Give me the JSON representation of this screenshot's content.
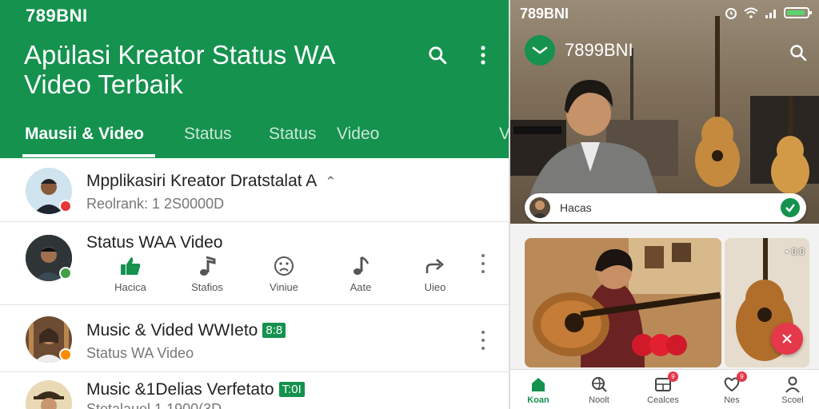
{
  "left": {
    "status_bar": {
      "text": "789BNI"
    },
    "header": {
      "title": "Apülasi Kreator Status WA Video Terbaik",
      "search_icon": "search-icon",
      "more_icon": "more-vert-icon"
    },
    "tabs": [
      {
        "label": "Mausii & Video"
      },
      {
        "label": "Status"
      },
      {
        "label": "Status"
      },
      {
        "label": "Video"
      },
      {
        "label": "V"
      }
    ],
    "rows": [
      {
        "title": "Mpplikasiri Kreator Dratstalat A",
        "subtitle": "Reolrank: 1 2S0000D",
        "badge_color": "#e53935"
      },
      {
        "title": "Status WAA Video",
        "badge_color": "#43a047"
      },
      {
        "title": "Music & Vided WWIeto",
        "tag": "8:8",
        "subtitle": "Status WA Video",
        "badge_color": "#fb8c00"
      },
      {
        "title": "Music &1Delias Verfetato",
        "tag": "T:0I",
        "subtitle": "Stetalauel 1 1900(3D"
      }
    ],
    "actions": [
      {
        "label": "Hacica",
        "icon": "thumbs-up-icon"
      },
      {
        "label": "Stafios",
        "icon": "music-note-icon"
      },
      {
        "label": "Viniue",
        "icon": "sad-face-icon"
      },
      {
        "label": "Aate",
        "icon": "music-note-icon"
      },
      {
        "label": "Uieo",
        "icon": "share-icon"
      }
    ]
  },
  "right": {
    "status_bar": {
      "text": "789BNI"
    },
    "header": {
      "title": "7899BNI"
    },
    "caption": {
      "text": "Hacas"
    },
    "card2_tag": "• 0:0",
    "nav": [
      {
        "label": "Koan",
        "icon": "home-icon",
        "active": true
      },
      {
        "label": "Noolt",
        "icon": "search-globe-icon"
      },
      {
        "label": "Cealces",
        "icon": "grid-icon",
        "badge": "9"
      },
      {
        "label": "Nes",
        "icon": "heart-icon",
        "badge": "9"
      },
      {
        "label": "Scoel",
        "icon": "profile-icon"
      }
    ]
  },
  "colors": {
    "primary": "#14924e",
    "accent_red": "#e5384a"
  }
}
